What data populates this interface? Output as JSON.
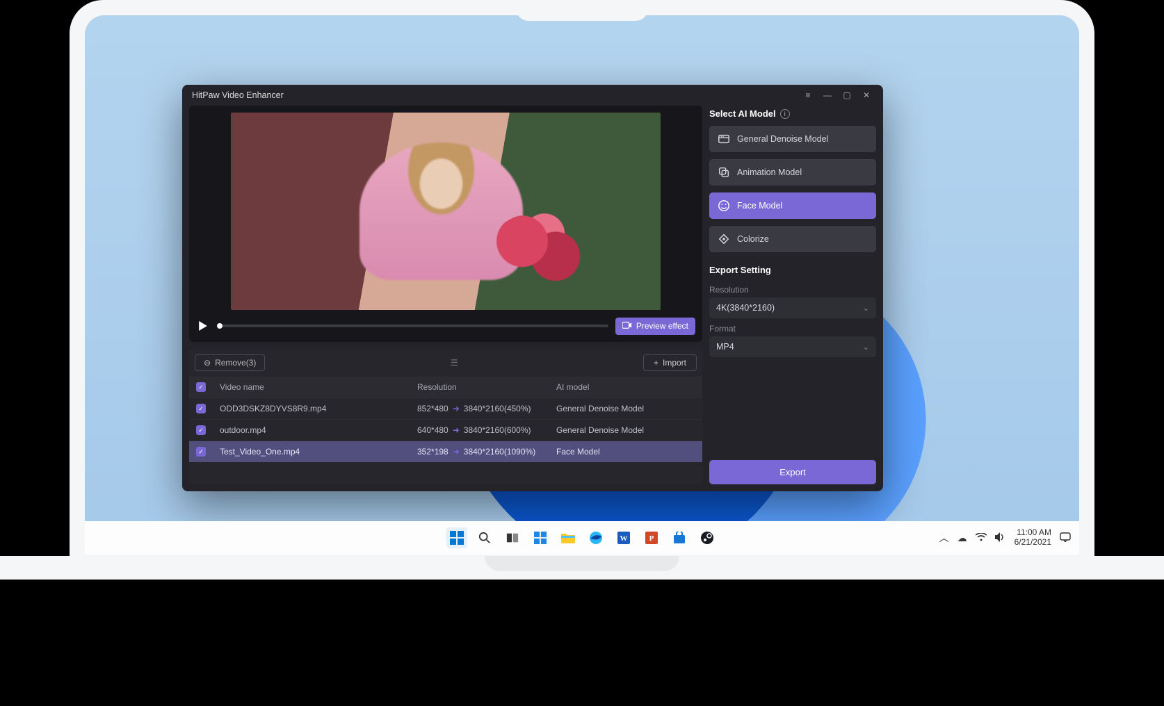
{
  "app": {
    "title": "HitPaw Video Enhancer"
  },
  "preview": {
    "preview_effect_label": "Preview effect"
  },
  "list": {
    "remove_label": "Remove(3)",
    "import_label": "Import",
    "headers": {
      "name": "Video name",
      "resolution": "Resolution",
      "model": "AI model"
    },
    "rows": [
      {
        "name": "ODD3DSKZ8DYVS8R9.mp4",
        "res_from": "852*480",
        "res_to": "3840*2160(450%)",
        "model": "General Denoise Model",
        "selected": false
      },
      {
        "name": "outdoor.mp4",
        "res_from": "640*480",
        "res_to": "3840*2160(600%)",
        "model": "General Denoise Model",
        "selected": false
      },
      {
        "name": "Test_Video_One.mp4",
        "res_from": "352*198",
        "res_to": "3840*2160(1090%)",
        "model": "Face Model",
        "selected": true
      }
    ]
  },
  "models": {
    "section_label": "Select AI Model",
    "items": [
      {
        "label": "General Denoise Model",
        "active": false
      },
      {
        "label": "Animation Model",
        "active": false
      },
      {
        "label": "Face Model",
        "active": true
      },
      {
        "label": "Colorize",
        "active": false
      }
    ]
  },
  "export": {
    "section_label": "Export Setting",
    "resolution_label": "Resolution",
    "resolution_value": "4K(3840*2160)",
    "format_label": "Format",
    "format_value": "MP4",
    "export_button": "Export"
  },
  "taskbar": {
    "time": "11:00 AM",
    "date": "6/21/2021"
  }
}
